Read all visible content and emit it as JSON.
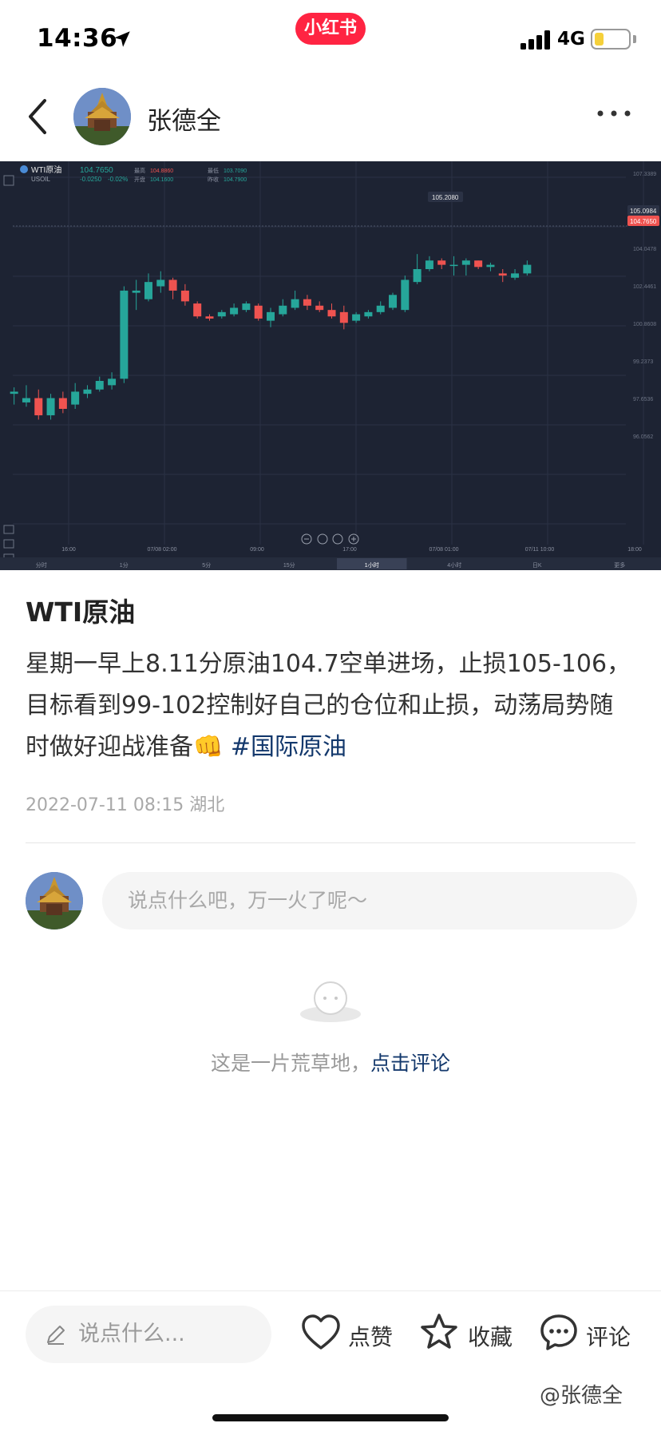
{
  "status_bar": {
    "time": "14:36",
    "app_badge": "小红书",
    "network": "4G",
    "battery_level": 0.25
  },
  "header": {
    "author_name": "张德全"
  },
  "chart": {
    "symbol": "WTI原油",
    "code": "USOIL",
    "last_price": "104.7650",
    "change": "-0.0250",
    "change_pct": "-0.02%",
    "info_labels": [
      "最高",
      "开盘",
      "最低",
      "昨收"
    ],
    "info_values": [
      "104.8860",
      "104.1600",
      "103.7090",
      "104.7900"
    ],
    "high_marker": "105.2080",
    "current_tag": "105.0984",
    "price_tag": "104.7650",
    "x_ticks": [
      "16:00",
      "07/08 02:00",
      "09:00",
      "17:00",
      "07/08 01:00",
      "07/11 10:00",
      "18:00"
    ],
    "y_ticks": [
      "107.3389",
      "105.6313",
      "104.0478",
      "102.4461",
      "100.8608",
      "99.2373",
      "97.6536",
      "96.0562"
    ],
    "timeframes": [
      "分时",
      "1分",
      "5分",
      "15分",
      "1小时",
      "4小时",
      "日K",
      "更多"
    ],
    "active_timeframe": "1小时",
    "chart_data": {
      "type": "candlestick",
      "symbol": "WTI原油",
      "ylim": [
        95.5,
        108.5
      ],
      "candles": [
        {
          "o": 98.8,
          "h": 99.1,
          "l": 98.3,
          "c": 98.9
        },
        {
          "o": 98.4,
          "h": 99.2,
          "l": 98.2,
          "c": 98.6
        },
        {
          "o": 98.6,
          "h": 99.0,
          "l": 97.6,
          "c": 97.8
        },
        {
          "o": 97.8,
          "h": 98.8,
          "l": 97.6,
          "c": 98.6
        },
        {
          "o": 98.6,
          "h": 98.9,
          "l": 97.9,
          "c": 98.1
        },
        {
          "o": 98.3,
          "h": 99.3,
          "l": 98.1,
          "c": 98.9
        },
        {
          "o": 98.8,
          "h": 99.2,
          "l": 98.6,
          "c": 99.0
        },
        {
          "o": 99.0,
          "h": 99.6,
          "l": 98.9,
          "c": 99.4
        },
        {
          "o": 99.2,
          "h": 99.8,
          "l": 99.0,
          "c": 99.5
        },
        {
          "o": 99.5,
          "h": 103.8,
          "l": 99.3,
          "c": 103.6
        },
        {
          "o": 103.5,
          "h": 104.1,
          "l": 102.7,
          "c": 103.6
        },
        {
          "o": 103.2,
          "h": 104.4,
          "l": 103.1,
          "c": 104.0
        },
        {
          "o": 103.8,
          "h": 104.5,
          "l": 103.5,
          "c": 104.1
        },
        {
          "o": 104.1,
          "h": 104.2,
          "l": 103.2,
          "c": 103.6
        },
        {
          "o": 103.6,
          "h": 103.9,
          "l": 102.9,
          "c": 103.1
        },
        {
          "o": 103.0,
          "h": 103.1,
          "l": 102.3,
          "c": 102.4
        },
        {
          "o": 102.4,
          "h": 102.5,
          "l": 102.2,
          "c": 102.3
        },
        {
          "o": 102.4,
          "h": 102.7,
          "l": 102.3,
          "c": 102.6
        },
        {
          "o": 102.5,
          "h": 103.0,
          "l": 102.4,
          "c": 102.8
        },
        {
          "o": 102.7,
          "h": 103.1,
          "l": 102.6,
          "c": 103.0
        },
        {
          "o": 102.9,
          "h": 103.0,
          "l": 102.2,
          "c": 102.3
        },
        {
          "o": 102.2,
          "h": 102.8,
          "l": 101.9,
          "c": 102.6
        },
        {
          "o": 102.5,
          "h": 103.2,
          "l": 102.4,
          "c": 102.9
        },
        {
          "o": 102.8,
          "h": 103.6,
          "l": 102.7,
          "c": 103.2
        },
        {
          "o": 103.2,
          "h": 103.4,
          "l": 102.7,
          "c": 102.9
        },
        {
          "o": 102.9,
          "h": 103.1,
          "l": 102.6,
          "c": 102.7
        },
        {
          "o": 102.7,
          "h": 103.0,
          "l": 102.3,
          "c": 102.4
        },
        {
          "o": 102.6,
          "h": 102.9,
          "l": 101.8,
          "c": 102.1
        },
        {
          "o": 102.2,
          "h": 102.6,
          "l": 102.1,
          "c": 102.5
        },
        {
          "o": 102.4,
          "h": 102.7,
          "l": 102.3,
          "c": 102.6
        },
        {
          "o": 102.6,
          "h": 103.1,
          "l": 102.5,
          "c": 102.9
        },
        {
          "o": 102.8,
          "h": 103.5,
          "l": 102.7,
          "c": 103.4
        },
        {
          "o": 102.7,
          "h": 104.3,
          "l": 102.6,
          "c": 104.1
        },
        {
          "o": 104.0,
          "h": 105.3,
          "l": 103.9,
          "c": 104.6
        },
        {
          "o": 104.6,
          "h": 105.2,
          "l": 104.5,
          "c": 105.0
        },
        {
          "o": 105.0,
          "h": 105.1,
          "l": 104.6,
          "c": 104.8
        },
        {
          "o": 104.8,
          "h": 105.2,
          "l": 104.3,
          "c": 104.8
        },
        {
          "o": 104.8,
          "h": 105.1,
          "l": 104.3,
          "c": 105.0
        },
        {
          "o": 105.0,
          "h": 105.0,
          "l": 104.6,
          "c": 104.7
        },
        {
          "o": 104.7,
          "h": 104.9,
          "l": 104.5,
          "c": 104.8
        },
        {
          "o": 104.4,
          "h": 104.6,
          "l": 104.0,
          "c": 104.3
        },
        {
          "o": 104.2,
          "h": 104.6,
          "l": 104.1,
          "c": 104.4
        },
        {
          "o": 104.4,
          "h": 105.0,
          "l": 104.3,
          "c": 104.8
        }
      ]
    }
  },
  "post": {
    "title": "WTI原油",
    "body": "星期一早上8.11分原油104.7空单进场，止损105-106，目标看到99-102控制好自己的仓位和止损，动荡局势随时做好迎战准备👊",
    "hashtag": "#国际原油",
    "meta": "2022-07-11 08:15 湖北"
  },
  "comment_box": {
    "placeholder": "说点什么吧，万一火了呢～"
  },
  "empty_state": {
    "text": "这是一片荒草地，",
    "link": "点击评论"
  },
  "bottom_bar": {
    "input_placeholder": "说点什么...",
    "like_label": "点赞",
    "fav_label": "收藏",
    "comment_label": "评论",
    "watermark": "@张德全"
  },
  "colors": {
    "brand": "#ff2442",
    "link": "#13386c",
    "chart_bg": "#1d2333",
    "up": "#26a69a",
    "down": "#ef5350"
  },
  "icons": [
    "location-arrow-icon",
    "signal-icon",
    "battery-icon",
    "back-icon",
    "more-icon",
    "edit-icon",
    "heart-icon",
    "star-icon",
    "comment-icon",
    "empty-comment-icon"
  ]
}
